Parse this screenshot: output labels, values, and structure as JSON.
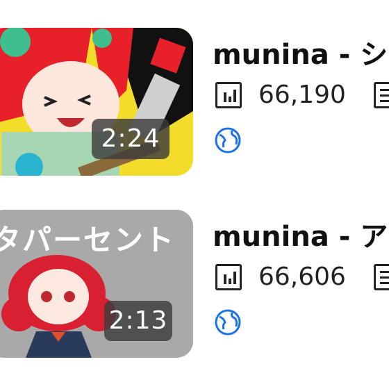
{
  "videos": [
    {
      "title": "munina - シ",
      "duration": "2:24",
      "views": "66,190",
      "visibility_icon": "globe-icon",
      "stats_icon": "bar-chart-icon"
    },
    {
      "title": "munina - ア",
      "duration": "2:13",
      "views": "66,606",
      "visibility_icon": "globe-icon",
      "stats_icon": "bar-chart-icon",
      "thumbnail_text": "タパーセント"
    }
  ],
  "colors": {
    "globe": "#1a73e8",
    "thumb1_bg": "#f4dd2a",
    "thumb2_bg": "#a9a9a9"
  }
}
